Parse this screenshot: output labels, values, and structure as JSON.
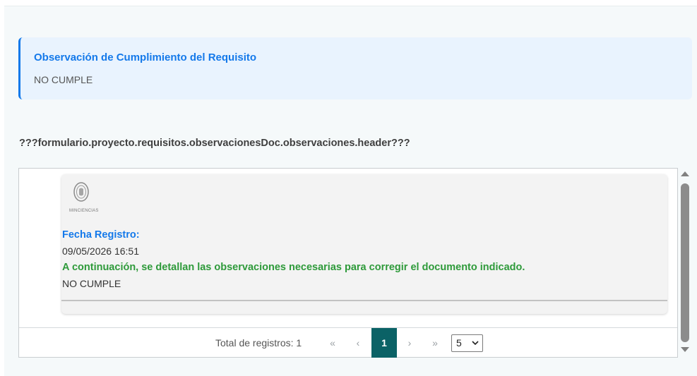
{
  "callout": {
    "title": "Observación de Cumplimiento del Requisito",
    "value": "NO CUMPLE"
  },
  "section": {
    "header": "???formulario.proyecto.requisitos.observacionesDoc.observaciones.header???"
  },
  "record": {
    "logo_text": "MINCIENCIAS",
    "logo_icon": "seal-icon",
    "date_label": "Fecha Registro:",
    "date_value": "09/05/2026 16:51",
    "obs_intro": "A continuación, se detallan las observaciones necesarias para corregir el documento indicado.",
    "obs_value": "NO CUMPLE"
  },
  "pager": {
    "total_label": "Total de registros: 1",
    "first": "«",
    "prev": "‹",
    "current_page": "1",
    "next": "›",
    "last": "»",
    "page_size": "5"
  },
  "colors": {
    "accent_blue": "#1479ea",
    "success_green": "#2e9a3a",
    "pager_active": "#0b6266"
  }
}
